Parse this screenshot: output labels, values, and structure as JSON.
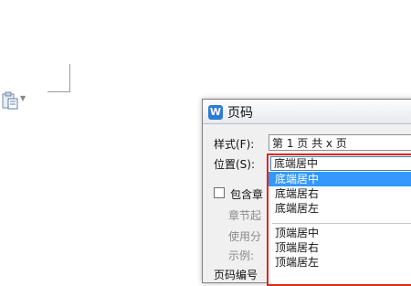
{
  "dialog": {
    "title": "页码",
    "app_icon_letter": "W",
    "style_label": "样式(F):",
    "style_value": "第 1 页 共 x 页",
    "position_label": "位置(S):",
    "position_value": "底端居中",
    "include_chapter_label": "包含章",
    "chapter_start_label": "章节起",
    "use_separator_label": "使用分",
    "example_label": "示例:",
    "page_number_label": "页码编号"
  },
  "position_options": [
    {
      "label": "底端居中",
      "selected": true
    },
    {
      "label": "底端居右",
      "selected": false
    },
    {
      "label": "底端居左",
      "selected": false
    },
    {
      "label": "顶端居中",
      "selected": false
    },
    {
      "label": "顶端居右",
      "selected": false
    },
    {
      "label": "顶端居左",
      "selected": false
    }
  ],
  "colors": {
    "highlight_frame": "#e0261f",
    "selection": "#3399ff",
    "app_icon": "#2b7bd4"
  },
  "icons": {
    "toolbar": "paste-icon",
    "dropdown_arrow": "chevron-down-icon"
  }
}
